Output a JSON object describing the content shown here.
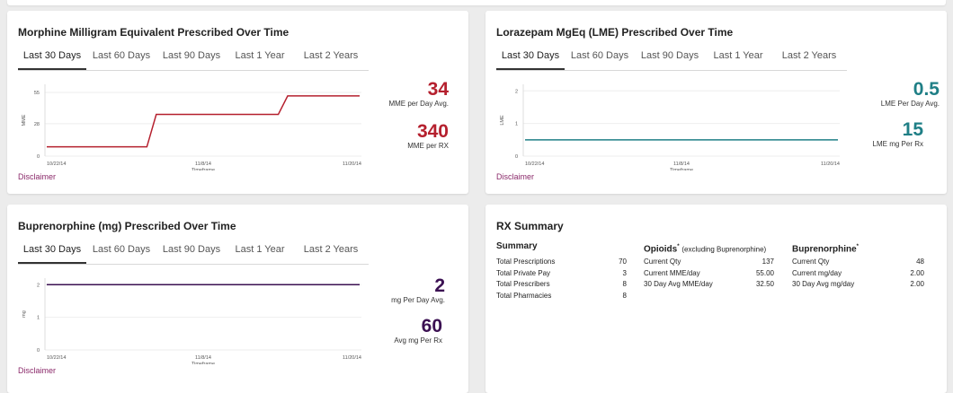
{
  "tabs": [
    "Last 30 Days",
    "Last 60 Days",
    "Last 90 Days",
    "Last 1 Year",
    "Last 2 Years"
  ],
  "disclaimer": "Disclaimer",
  "mme": {
    "title": "Morphine Milligram Equivalent Prescribed Over Time",
    "avg_value": "34",
    "avg_label": "MME per Day Avg.",
    "rx_value": "340",
    "rx_label": "MME per RX",
    "color": "#b5202e"
  },
  "lme": {
    "title": "Lorazepam MgEq (LME) Prescribed Over Time",
    "avg_value": "0.5",
    "avg_label": "LME Per Day Avg.",
    "rx_value": "15",
    "rx_label": "LME mg Per Rx",
    "color": "#1f7f86"
  },
  "bup": {
    "title": "Buprenorphine (mg) Prescribed Over Time",
    "avg_value": "2",
    "avg_label": "mg Per Day Avg.",
    "rx_value": "60",
    "rx_label": "Avg mg Per Rx",
    "color": "#3b1052"
  },
  "chart_data": [
    {
      "type": "line",
      "title": "Morphine Milligram Equivalent Prescribed Over Time",
      "xlabel": "Timeframe",
      "ylabel": "MME",
      "x_ticks": [
        "10/22/14",
        "11/8/14",
        "11/20/14"
      ],
      "y_ticks": [
        0,
        28,
        55
      ],
      "ylim": [
        0,
        62
      ],
      "series": [
        {
          "x": [
            0,
            0.32,
            0.35,
            0.74,
            0.77,
            1.0
          ],
          "values": [
            8,
            8,
            36,
            36,
            52,
            52
          ]
        }
      ]
    },
    {
      "type": "line",
      "title": "Lorazepam MgEq (LME) Prescribed Over Time",
      "xlabel": "Timeframe",
      "ylabel": "LME",
      "x_ticks": [
        "10/22/14",
        "11/8/14",
        "11/20/14"
      ],
      "y_ticks": [
        0,
        1,
        2
      ],
      "ylim": [
        0,
        2.2
      ],
      "series": [
        {
          "x": [
            0,
            1.0
          ],
          "values": [
            0.5,
            0.5
          ]
        }
      ]
    },
    {
      "type": "line",
      "title": "Buprenorphine (mg) Prescribed Over Time",
      "xlabel": "Timeframe",
      "ylabel": "mg",
      "x_ticks": [
        "10/22/14",
        "11/8/14",
        "11/20/14"
      ],
      "y_ticks": [
        0,
        1,
        2
      ],
      "ylim": [
        0,
        2.2
      ],
      "series": [
        {
          "x": [
            0,
            1.0
          ],
          "values": [
            2,
            2
          ]
        }
      ]
    }
  ],
  "rx": {
    "title": "RX Summary",
    "summary": {
      "head": "Summary",
      "rows": [
        {
          "label": "Total Prescriptions",
          "value": "70"
        },
        {
          "label": "Total Private Pay",
          "value": "3"
        },
        {
          "label": "Total Prescribers",
          "value": "8"
        },
        {
          "label": "Total Pharmacies",
          "value": "8"
        }
      ]
    },
    "opioids": {
      "head": "Opioids",
      "sup": "*",
      "sub": "(excluding Buprenorphine)",
      "rows": [
        {
          "label": "Current Qty",
          "value": "137"
        },
        {
          "label": "Current MME/day",
          "value": "55.00"
        },
        {
          "label": "30 Day Avg MME/day",
          "value": "32.50"
        }
      ]
    },
    "bup": {
      "head": "Buprenorphine",
      "sup": "*",
      "rows": [
        {
          "label": "Current Qty",
          "value": "48"
        },
        {
          "label": "Current mg/day",
          "value": "2.00"
        },
        {
          "label": "30 Day Avg mg/day",
          "value": "2.00"
        }
      ]
    }
  }
}
